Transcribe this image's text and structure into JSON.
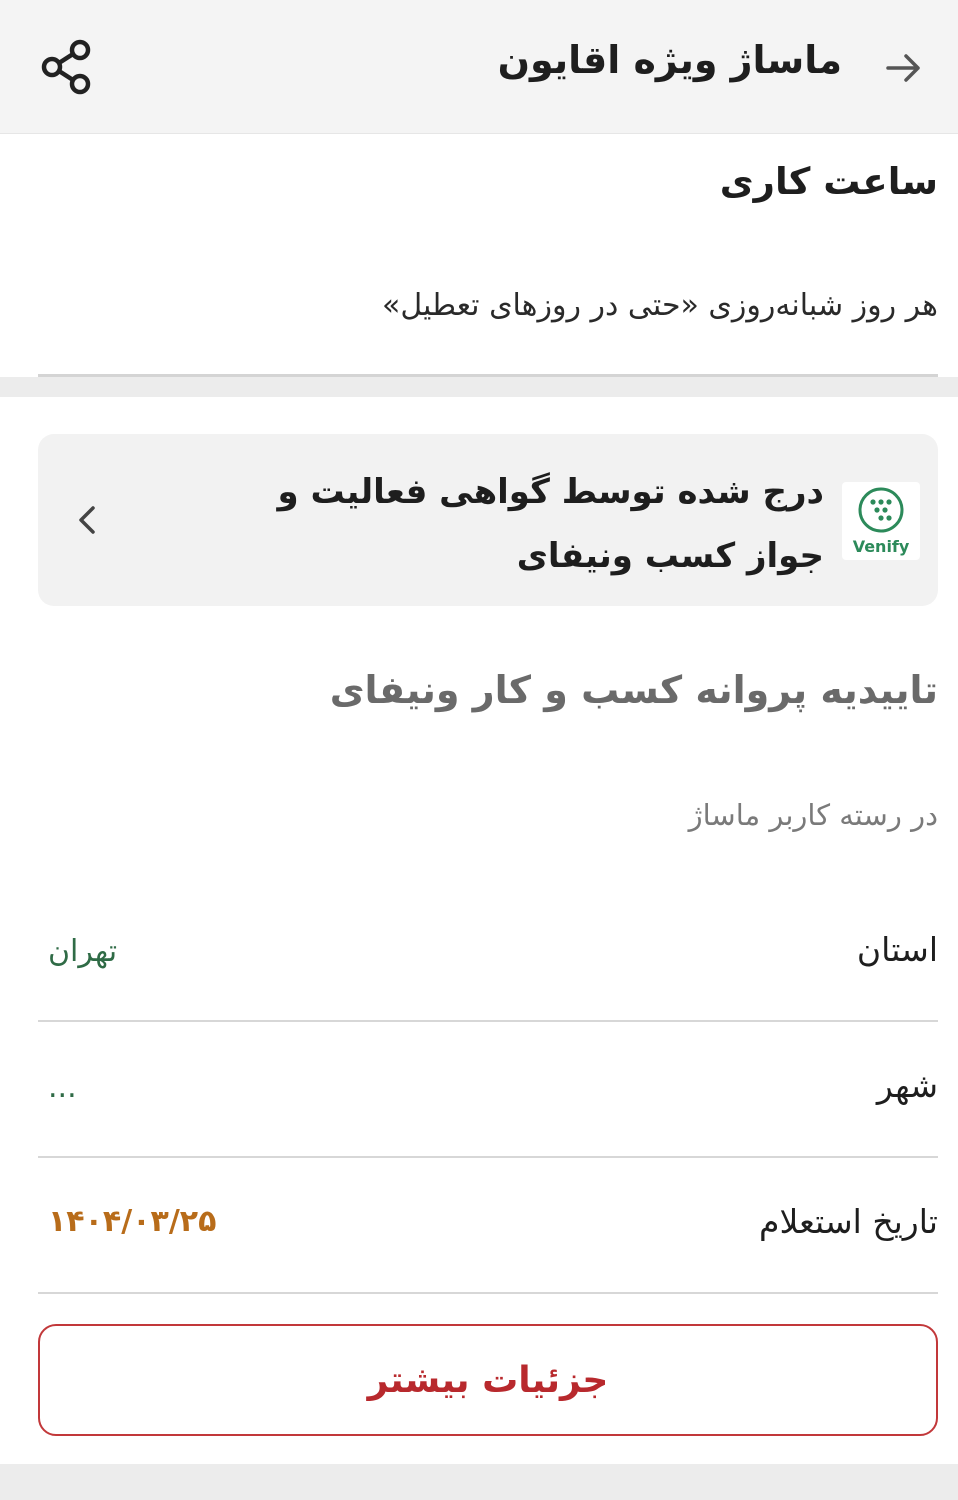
{
  "header": {
    "title": "ماساژ ویژه اقایون",
    "back_icon": "arrow-right-icon",
    "share_icon": "share-icon"
  },
  "working_hours": {
    "heading": "ساعت کاری",
    "text": "هر روز شبانه‌روزی «حتی در روزهای تعطیل»"
  },
  "verification_card": {
    "text": "درج شده توسط گواهی فعالیت و جواز کسب ونیفای",
    "logo_label": "Venify",
    "logo_icon": "venify-logo",
    "chevron_icon": "chevron-left-icon"
  },
  "license": {
    "heading": "تاییدیه پروانه کسب و کار ونیفای",
    "subtitle": "در رسته کاربر ماساژ",
    "rows": [
      {
        "label": "استان",
        "value": "تهران"
      },
      {
        "label": "شهر",
        "value": "..."
      },
      {
        "label": "تاریخ استعلام",
        "value": "۱۴۰۴/۰۳/۲۵"
      }
    ],
    "more_button": "جزئیات بیشتر"
  },
  "colors": {
    "accent_red": "#c2383a",
    "value_green": "#2f6b46",
    "date_orange": "#b86c1a",
    "brand_green": "#2c8a5a"
  }
}
